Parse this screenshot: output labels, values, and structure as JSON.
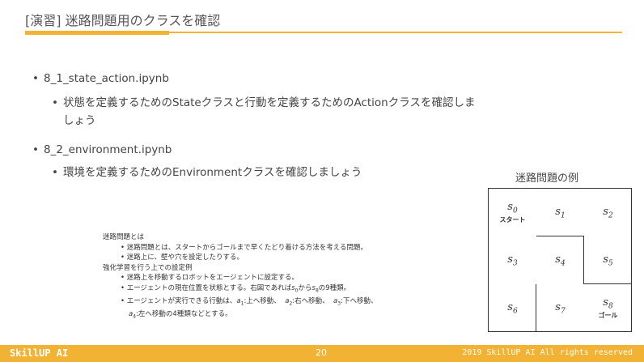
{
  "title": "[演習] 迷路問題用のクラスを確認",
  "bullets": [
    {
      "text": "8_1_state_action.ipynb",
      "sub": "状態を定義するためのStateクラスと行動を定義するためのActionクラスを確認しま",
      "sub2": "しょう"
    },
    {
      "text": "8_2_environment.ipynb",
      "sub": "環境を定義するためのEnvironmentクラスを確認しましょう"
    }
  ],
  "notes": {
    "h1": "迷路問題とは",
    "n1": "迷路問題とは、スタートからゴールまで早くたどり着ける方法を考える問題。",
    "n2": "迷路上に、壁や穴を設定したりする。",
    "h2": "強化学習を行う上での設定例",
    "n3": "迷路上を移動するロボットをエージェントに設定する。",
    "n4a": "エージェントの現在位置を状態とする。右図であれば",
    "n4b": "から",
    "n4c": "の9種類。",
    "n5a": "エージェントが実行できる行動は、",
    "n5b": ":上へ移動、",
    "n5c": ":右へ移動、",
    "n5d": ":下へ移動、",
    "n6": ":左へ移動の4種類などとする。"
  },
  "maze": {
    "title": "迷路問題の例",
    "start_label": "スタート",
    "goal_label": "ゴール"
  },
  "footer": {
    "brand": "SkillUP AI",
    "page": "20",
    "copyright": "2019 SkillUP AI All rights reserved"
  },
  "colors": {
    "accent": "#f2b233"
  }
}
